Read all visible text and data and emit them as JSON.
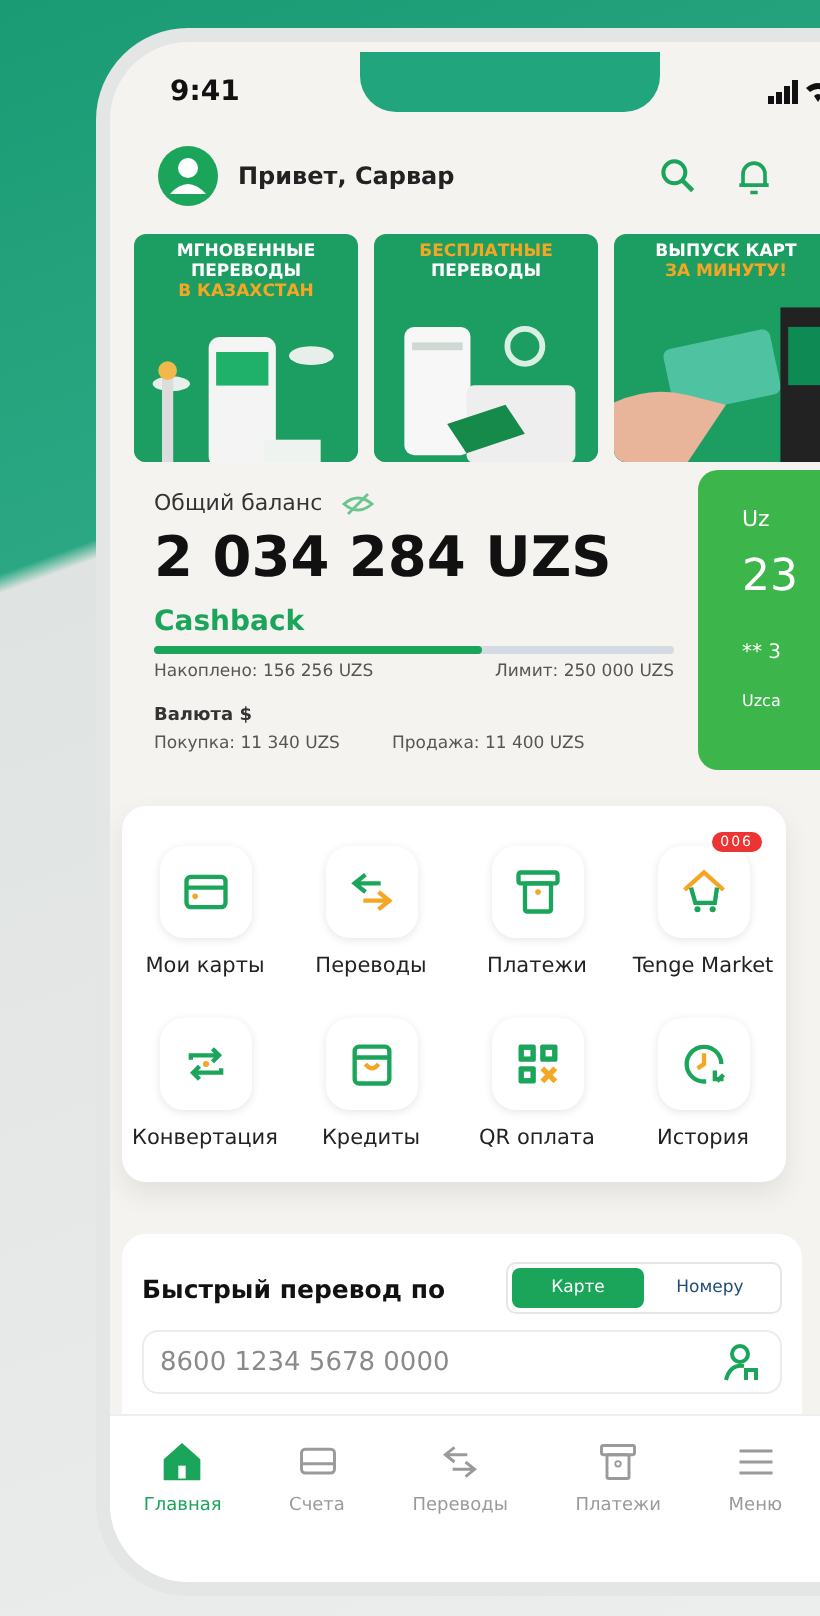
{
  "status_bar": {
    "time": "9:41"
  },
  "header": {
    "greeting": "Привет, Сарвар"
  },
  "banners": [
    {
      "lines": [
        {
          "text": "МГНОВЕННЫЕ ПЕРЕВОДЫ",
          "accent": false
        },
        {
          "text": "В КАЗАХСТАН",
          "accent": true
        }
      ]
    },
    {
      "lines": [
        {
          "text": "БЕСПЛАТНЫЕ",
          "accent": true
        },
        {
          "text": "ПЕРЕВОДЫ",
          "accent": false
        }
      ]
    },
    {
      "lines": [
        {
          "text": "ВЫПУСК КАРТ",
          "accent": false
        },
        {
          "text": "ЗА МИНУТУ!",
          "accent": true
        }
      ]
    }
  ],
  "balance": {
    "label": "Общий баланс",
    "amount": "2 034 284 UZS",
    "cashback_title": "Cashback",
    "level": 0.63,
    "accumulated": "Накоплено: 156 256 UZS",
    "limit": "Лимит: 250 000 UZS",
    "currency_title": "Валюта $",
    "buy": "Покупка: 11 340 UZS",
    "sell": "Продажа: 11 400 UZS"
  },
  "side_card": {
    "title": "Uz",
    "amount": "23",
    "number": "** 3",
    "footer": "Uzca"
  },
  "services": [
    {
      "kind": "card",
      "label": "Мои карты"
    },
    {
      "kind": "transfer",
      "label": "Переводы"
    },
    {
      "kind": "payment",
      "label": "Платежи"
    },
    {
      "kind": "market",
      "label": "Tenge Market",
      "badge": "006"
    },
    {
      "kind": "convert",
      "label": "Конвертация"
    },
    {
      "kind": "credit",
      "label": "Кредиты"
    },
    {
      "kind": "qr",
      "label": "QR оплата"
    },
    {
      "kind": "history",
      "label": "История"
    }
  ],
  "quick_transfer": {
    "title": "Быстрый перевод по",
    "options": [
      {
        "label": "Карте",
        "selected": true
      },
      {
        "label": "Номеру",
        "selected": false
      }
    ],
    "placeholder": "8600 1234 5678 0000"
  },
  "nav": [
    {
      "kind": "home",
      "label": "Главная",
      "selected": true
    },
    {
      "kind": "accounts",
      "label": "Счета",
      "selected": false
    },
    {
      "kind": "transfer",
      "label": "Переводы",
      "selected": false
    },
    {
      "kind": "payment",
      "label": "Платежи",
      "selected": false
    },
    {
      "kind": "menu",
      "label": "Меню",
      "selected": false
    }
  ]
}
